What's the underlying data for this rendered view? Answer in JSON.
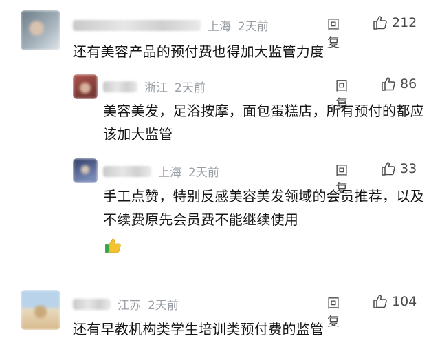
{
  "comments": [
    {
      "username": "Pingueli·明 F Y",
      "location": "上海",
      "time": "2天前",
      "reply_label": "回复",
      "likes": "212",
      "text": "还有美容产品的预付费也得加大监管力度",
      "avatar_colors": [
        "#6b7a86",
        "#a8b5be"
      ]
    },
    {
      "username": "何 若",
      "location": "浙江",
      "time": "2天前",
      "reply_label": "回复",
      "likes": "86",
      "text": "美容美发，足浴按摩，面包蛋糕店，所有预付的都应该加大监管",
      "avatar_colors": [
        "#b0524b",
        "#d9b39f"
      ]
    },
    {
      "username": "崔 灯 阳",
      "location": "上海",
      "time": "2天前",
      "reply_label": "回复",
      "likes": "33",
      "text": "手工点赞，特别反感美容美发领域的会员推荐，以及不续费原先会员费不能继续使用",
      "emoji": "thumbs-up",
      "avatar_colors": [
        "#2f3d66",
        "#7a8bb8"
      ]
    },
    {
      "username": "W 小 y",
      "location": "江苏",
      "time": "2天前",
      "reply_label": "回复",
      "likes": "104",
      "text": "还有早教机构类学生培训类预付费的监管",
      "avatar_colors": [
        "#c9a97a",
        "#e9dcc0"
      ]
    }
  ],
  "colors": {
    "meta_gray": "#9aa0a6",
    "text": "#151515",
    "action": "#4a4a4a"
  }
}
